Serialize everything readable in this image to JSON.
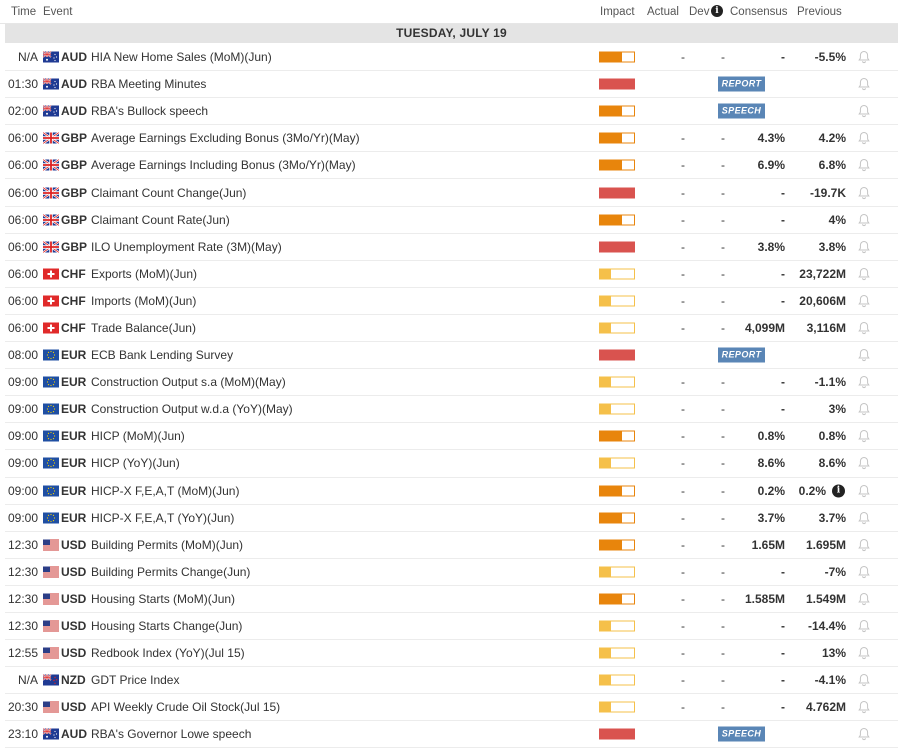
{
  "header": {
    "time": "Time",
    "event": "Event",
    "impact": "Impact",
    "actual": "Actual",
    "dev": "Dev",
    "dev_info": "i",
    "consensus": "Consensus",
    "previous": "Previous"
  },
  "day_label": "TUESDAY, JULY 19",
  "colors": {
    "high": "#d9534f",
    "medium": "#e8850c",
    "low": "#f5c04a",
    "tag": "#5a86b6"
  },
  "events": [
    {
      "time": "N/A",
      "flag": "au",
      "currency": "AUD",
      "event": "HIA New Home Sales (MoM)(Jun)",
      "impact": "medium",
      "actual": "-",
      "dev": "-",
      "consensus": "-",
      "previous": "-5.5%"
    },
    {
      "time": "01:30",
      "flag": "au",
      "currency": "AUD",
      "event": "RBA Meeting Minutes",
      "impact": "high",
      "tag": "REPORT"
    },
    {
      "time": "02:00",
      "flag": "au",
      "currency": "AUD",
      "event": "RBA's Bullock speech",
      "impact": "medium",
      "tag": "SPEECH"
    },
    {
      "time": "06:00",
      "flag": "gb",
      "currency": "GBP",
      "event": "Average Earnings Excluding Bonus (3Mo/Yr)(May)",
      "impact": "medium",
      "actual": "-",
      "dev": "-",
      "consensus": "4.3%",
      "previous": "4.2%"
    },
    {
      "time": "06:00",
      "flag": "gb",
      "currency": "GBP",
      "event": "Average Earnings Including Bonus (3Mo/Yr)(May)",
      "impact": "medium",
      "actual": "-",
      "dev": "-",
      "consensus": "6.9%",
      "previous": "6.8%"
    },
    {
      "time": "06:00",
      "flag": "gb",
      "currency": "GBP",
      "event": "Claimant Count Change(Jun)",
      "impact": "high",
      "actual": "-",
      "dev": "-",
      "consensus": "-",
      "previous": "-19.7K"
    },
    {
      "time": "06:00",
      "flag": "gb",
      "currency": "GBP",
      "event": "Claimant Count Rate(Jun)",
      "impact": "medium",
      "actual": "-",
      "dev": "-",
      "consensus": "-",
      "previous": "4%"
    },
    {
      "time": "06:00",
      "flag": "gb",
      "currency": "GBP",
      "event": "ILO Unemployment Rate (3M)(May)",
      "impact": "high",
      "actual": "-",
      "dev": "-",
      "consensus": "3.8%",
      "previous": "3.8%"
    },
    {
      "time": "06:00",
      "flag": "ch",
      "currency": "CHF",
      "event": "Exports (MoM)(Jun)",
      "impact": "low",
      "actual": "-",
      "dev": "-",
      "consensus": "-",
      "previous": "23,722M"
    },
    {
      "time": "06:00",
      "flag": "ch",
      "currency": "CHF",
      "event": "Imports (MoM)(Jun)",
      "impact": "low",
      "actual": "-",
      "dev": "-",
      "consensus": "-",
      "previous": "20,606M"
    },
    {
      "time": "06:00",
      "flag": "ch",
      "currency": "CHF",
      "event": "Trade Balance(Jun)",
      "impact": "low",
      "actual": "-",
      "dev": "-",
      "consensus": "4,099M",
      "previous": "3,116M"
    },
    {
      "time": "08:00",
      "flag": "eu",
      "currency": "EUR",
      "event": "ECB Bank Lending Survey",
      "impact": "high",
      "tag": "REPORT"
    },
    {
      "time": "09:00",
      "flag": "eu",
      "currency": "EUR",
      "event": "Construction Output s.a (MoM)(May)",
      "impact": "low",
      "actual": "-",
      "dev": "-",
      "consensus": "-",
      "previous": "-1.1%"
    },
    {
      "time": "09:00",
      "flag": "eu",
      "currency": "EUR",
      "event": "Construction Output w.d.a (YoY)(May)",
      "impact": "low",
      "actual": "-",
      "dev": "-",
      "consensus": "-",
      "previous": "3%"
    },
    {
      "time": "09:00",
      "flag": "eu",
      "currency": "EUR",
      "event": "HICP (MoM)(Jun)",
      "impact": "medium",
      "actual": "-",
      "dev": "-",
      "consensus": "0.8%",
      "previous": "0.8%"
    },
    {
      "time": "09:00",
      "flag": "eu",
      "currency": "EUR",
      "event": "HICP (YoY)(Jun)",
      "impact": "low",
      "actual": "-",
      "dev": "-",
      "consensus": "8.6%",
      "previous": "8.6%"
    },
    {
      "time": "09:00",
      "flag": "eu",
      "currency": "EUR",
      "event": "HICP-X F,E,A,T (MoM)(Jun)",
      "impact": "medium",
      "actual": "-",
      "dev": "-",
      "consensus": "0.2%",
      "previous": "0.2%",
      "info": "i"
    },
    {
      "time": "09:00",
      "flag": "eu",
      "currency": "EUR",
      "event": "HICP-X F,E,A,T (YoY)(Jun)",
      "impact": "medium",
      "actual": "-",
      "dev": "-",
      "consensus": "3.7%",
      "previous": "3.7%"
    },
    {
      "time": "12:30",
      "flag": "us",
      "currency": "USD",
      "event": "Building Permits (MoM)(Jun)",
      "impact": "medium",
      "actual": "-",
      "dev": "-",
      "consensus": "1.65M",
      "previous": "1.695M"
    },
    {
      "time": "12:30",
      "flag": "us",
      "currency": "USD",
      "event": "Building Permits Change(Jun)",
      "impact": "low",
      "actual": "-",
      "dev": "-",
      "consensus": "-",
      "previous": "-7%"
    },
    {
      "time": "12:30",
      "flag": "us",
      "currency": "USD",
      "event": "Housing Starts (MoM)(Jun)",
      "impact": "medium",
      "actual": "-",
      "dev": "-",
      "consensus": "1.585M",
      "previous": "1.549M"
    },
    {
      "time": "12:30",
      "flag": "us",
      "currency": "USD",
      "event": "Housing Starts Change(Jun)",
      "impact": "low",
      "actual": "-",
      "dev": "-",
      "consensus": "-",
      "previous": "-14.4%"
    },
    {
      "time": "12:55",
      "flag": "us",
      "currency": "USD",
      "event": "Redbook Index (YoY)(Jul 15)",
      "impact": "low",
      "actual": "-",
      "dev": "-",
      "consensus": "-",
      "previous": "13%"
    },
    {
      "time": "N/A",
      "flag": "nz",
      "currency": "NZD",
      "event": "GDT Price Index",
      "impact": "low",
      "actual": "-",
      "dev": "-",
      "consensus": "-",
      "previous": "-4.1%"
    },
    {
      "time": "20:30",
      "flag": "us",
      "currency": "USD",
      "event": "API Weekly Crude Oil Stock(Jul 15)",
      "impact": "low",
      "actual": "-",
      "dev": "-",
      "consensus": "-",
      "previous": "4.762M"
    },
    {
      "time": "23:10",
      "flag": "au",
      "currency": "AUD",
      "event": "RBA's Governor Lowe speech",
      "impact": "high",
      "tag": "SPEECH"
    }
  ]
}
